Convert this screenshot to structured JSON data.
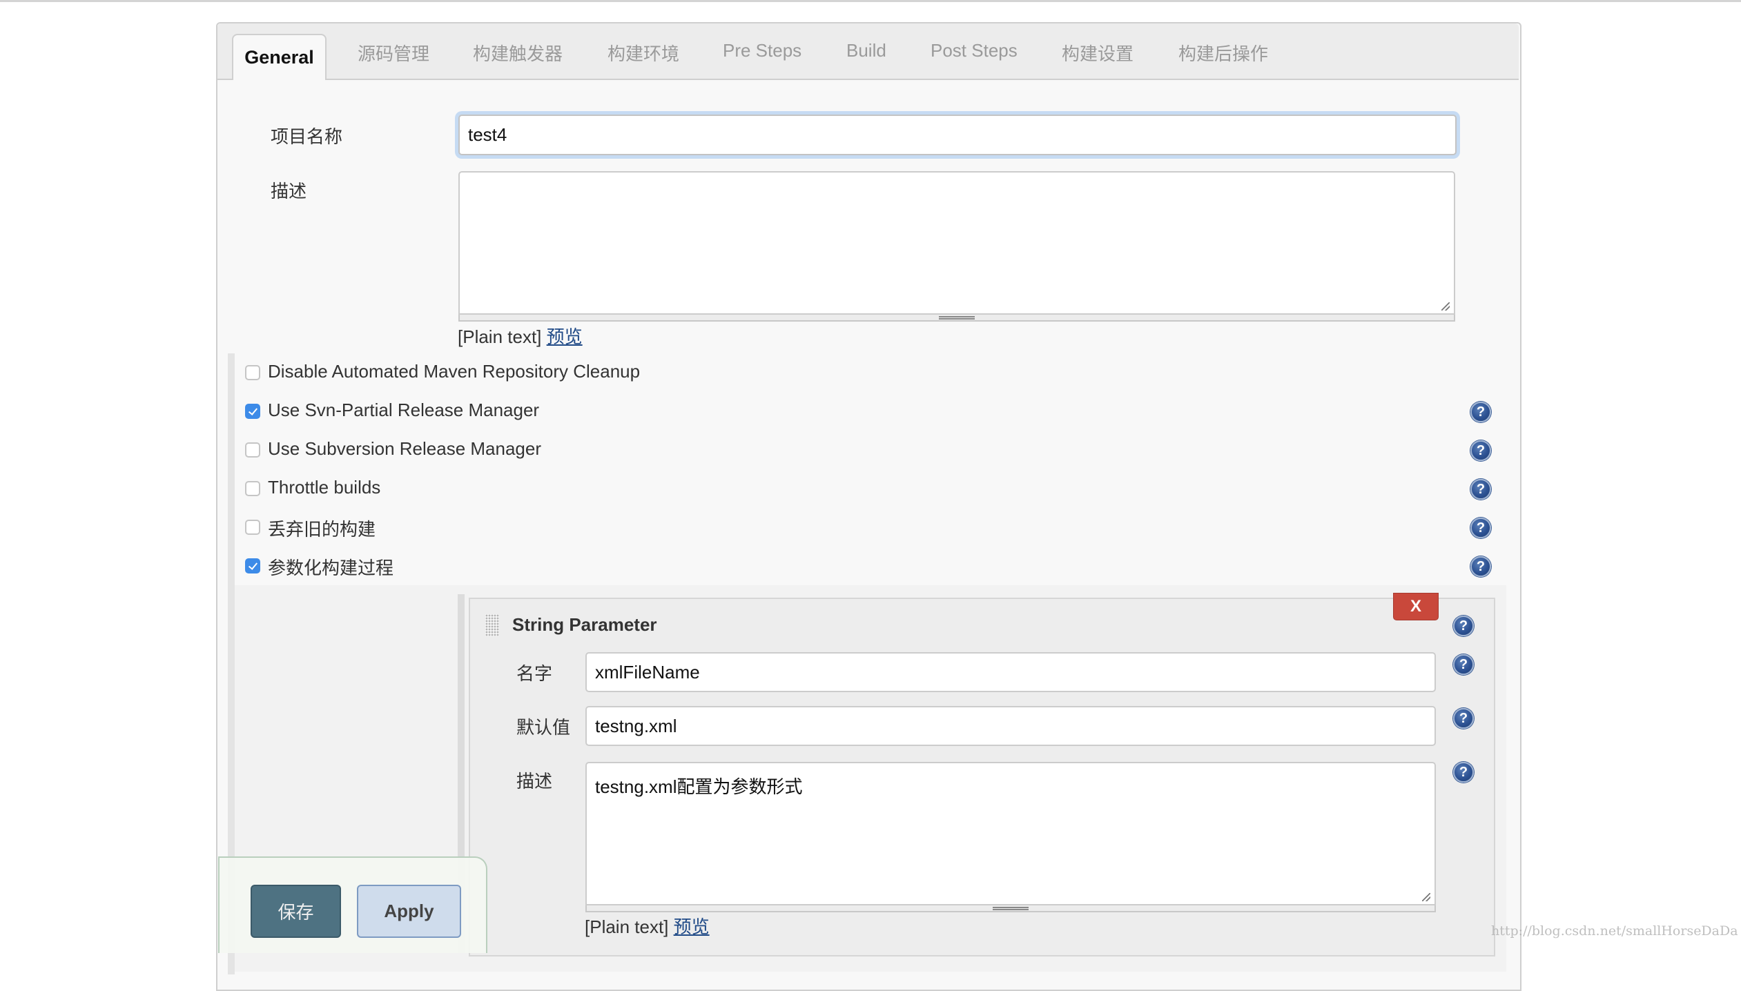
{
  "tabs": [
    {
      "label": "General",
      "active": true
    },
    {
      "label": "源码管理",
      "active": false
    },
    {
      "label": "构建触发器",
      "active": false
    },
    {
      "label": "构建环境",
      "active": false
    },
    {
      "label": "Pre Steps",
      "active": false
    },
    {
      "label": "Build",
      "active": false
    },
    {
      "label": "Post Steps",
      "active": false
    },
    {
      "label": "构建设置",
      "active": false
    },
    {
      "label": "构建后操作",
      "active": false
    }
  ],
  "general": {
    "project_name_label": "项目名称",
    "project_name_value": "test4",
    "description_label": "描述",
    "description_value": "",
    "format_label": "[Plain text]",
    "preview_link": "预览"
  },
  "options": [
    {
      "label": "Disable Automated Maven Repository Cleanup",
      "checked": false,
      "help": false
    },
    {
      "label": "Use Svn-Partial Release Manager",
      "checked": true,
      "help": true
    },
    {
      "label": "Use Subversion Release Manager",
      "checked": false,
      "help": true
    },
    {
      "label": "Throttle builds",
      "checked": false,
      "help": true
    },
    {
      "label": "丢弃旧的构建",
      "checked": false,
      "help": true
    },
    {
      "label": "参数化构建过程",
      "checked": true,
      "help": true
    }
  ],
  "parameter": {
    "title": "String Parameter",
    "delete_label": "X",
    "name_label": "名字",
    "name_value": "xmlFileName",
    "default_label": "默认值",
    "default_value": "testng.xml",
    "description_label": "描述",
    "description_value": "testng.xml配置为参数形式",
    "format_label": "[Plain text]",
    "preview_link": "预览"
  },
  "help_icon_glyph": "?",
  "actions": {
    "save_label": "保存",
    "apply_label": "Apply"
  },
  "watermark": "http://blog.csdn.net/smallHorseDaDa",
  "colors": {
    "checkbox_checked": "#3d8be8",
    "delete_button": "#c9483b",
    "save_button": "#4e7282",
    "apply_button": "#cfdcec",
    "link": "#204a87"
  }
}
